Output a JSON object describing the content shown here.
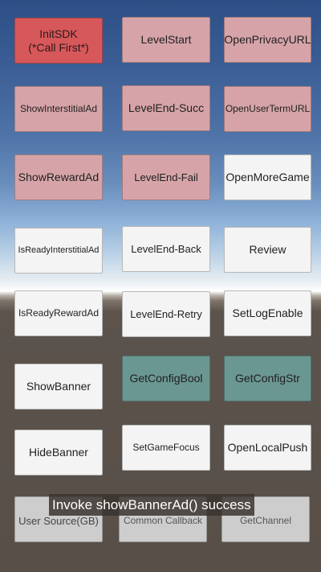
{
  "colors": {
    "init_red": "#d7585a",
    "pink": "#d6a4a8",
    "white": "#f4f4f4",
    "teal": "#6b9792",
    "grey": "#cdcdcd"
  },
  "buttons": {
    "init_sdk_line1": "InitSDK",
    "init_sdk_line2": "(*Call First*)",
    "level_start": "LevelStart",
    "open_privacy_url": "OpenPrivacyURL",
    "show_interstitial_ad": "ShowInterstitialAd",
    "level_end_succ": "LevelEnd-Succ",
    "open_user_term_url": "OpenUserTermURL",
    "show_reward_ad": "ShowRewardAd",
    "level_end_fail": "LevelEnd-Fail",
    "open_more_game": "OpenMoreGame",
    "is_ready_interstitial_ad": "IsReadyInterstitialAd",
    "level_end_back": "LevelEnd-Back",
    "review": "Review",
    "is_ready_reward_ad": "IsReadyRewardAd",
    "level_end_retry": "LevelEnd-Retry",
    "set_log_enable": "SetLogEnable",
    "show_banner": "ShowBanner",
    "get_config_bool": "GetConfigBool",
    "get_config_str": "GetConfigStr",
    "hide_banner": "HideBanner",
    "set_game_focus": "SetGameFocus",
    "open_local_push": "OpenLocalPush",
    "user_source": "User Source(GB)",
    "common_callback": "Common Callback",
    "get_channel": "GetChannel"
  },
  "toast": {
    "message": "Invoke showBannerAd() success"
  }
}
